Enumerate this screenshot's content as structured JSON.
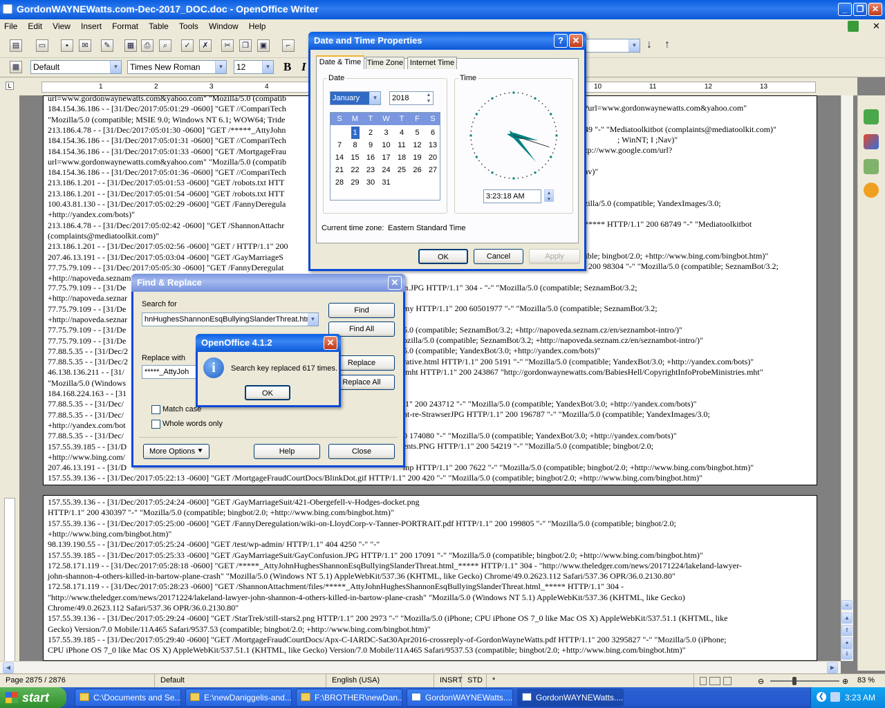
{
  "window": {
    "title": "GordonWAYNEWatts.com-Dec-2017_DOC.doc - OpenOffice Writer"
  },
  "menu": [
    "File",
    "Edit",
    "View",
    "Insert",
    "Format",
    "Table",
    "Tools",
    "Window",
    "Help"
  ],
  "format_toolbar": {
    "style": "Default",
    "font": "Times New Roman",
    "size": "12",
    "bold": "B",
    "italic": "I"
  },
  "ruler": {
    "ticks": [
      "1",
      "2",
      "3",
      "4",
      "5",
      "6",
      "7",
      "8",
      "9",
      "10",
      "11",
      "12",
      "13"
    ]
  },
  "page1_lines": [
    "url=www.gordonwaynewatts.com&yahoo.com\" \"Mozilla/5.0 (compatib",
    "184.154.36.186 - - [31/Dec/2017:05:01:29 -0600] \"GET //CompariTech",
    "\"Mozilla/5.0 (compatible; MSIE 9.0; Windows NT 6.1; WOW64; Tride",
    "213.186.4.78 - - [31/Dec/2017:05:01:30 -0600] \"GET /*****_AttyJohn",
    "184.154.36.186 - - [31/Dec/2017:05:01:31 -0600] \"GET //CompariTech",
    "184.154.36.186 - - [31/Dec/2017:05:01:33 -0600] \"GET /MortgageFrau",
    "url=www.gordonwaynewatts.com&yahoo.com\" \"Mozilla/5.0 (compatib",
    "184.154.36.186 - - [31/Dec/2017:05:01:36 -0600] \"GET //CompariTech",
    "213.186.1.201 - - [31/Dec/2017:05:01:53 -0600] \"GET /robots.txt HTT",
    "213.186.1.201 - - [31/Dec/2017:05:01:54 -0600] \"GET /robots.txt HTT",
    "100.43.81.130 - - [31/Dec/2017:05:02:29 -0600] \"GET /FannyDeregula",
    "+http://yandex.com/bots)\"",
    "213.186.4.78 - - [31/Dec/2017:05:02:42 -0600] \"GET /ShannonAttachr",
    "(complaints@mediatoolkit.com)\"",
    "213.186.1.201 - - [31/Dec/2017:05:02:56 -0600] \"GET / HTTP/1.1\" 200",
    "207.46.13.191 - - [31/Dec/2017:05:03:04 -0600] \"GET /GayMarriageS",
    "77.75.79.109 - - [31/Dec/2017:05:05:30 -0600] \"GET /FannyDeregulat",
    "+http://napoveda.seznam"
  ],
  "page1_right": [
    "?url=www.gordonwaynewatts.com&yahoo.com\"",
    "49 \"-\" \"Mediatoolkitbot (complaints@mediatoolkit.com)\"",
    "; WinNT; I ;Nav)\"",
    "ttp://www.google.com/url?",
    "av)\"",
    "zilla/5.0 (compatible; YandexImages/3.0;",
    "***** HTTP/1.1\" 200 68749 \"-\" \"Mediatoolkitbot",
    "tible; bingbot/2.0; +http://www.bing.com/bingbot.htm)\"",
    "\" 200 98304 \"-\" \"Mozilla/5.0 (compatible; SeznamBot/3.2;",
    "nan.JPG HTTP/1.1\" 304 - \"-\" \"Mozilla/5.0 (compatible; SeznamBot/3.2;",
    "my HTTP/1.1\" 200 60501977 \"-\" \"Mozilla/5.0 (compatible; SeznamBot/3.2;",
    "5.0 (compatible; SeznamBot/3.2; +http://napoveda.seznam.cz/en/seznambot-intro/)\"",
    "ozilla/5.0 (compatible; SeznamBot/3.2; +http://napoveda.seznam.cz/en/seznambot-intro/)\"",
    "5.0 (compatible; YandexBot/3.0; +http://yandex.com/bots)\"",
    "rative.html HTTP/1.1\" 200 5191 \"-\" \"Mozilla/5.0 (compatible; YandexBot/3.0; +http://yandex.com/bots)\"",
    ".mht HTTP/1.1\" 200 243867 \"http://gordonwaynewatts.com/BabiesHell/CopyrightInfoProbeMinistries.mht\"",
    ".1\" 200 243712 \"-\" \"Mozilla/5.0 (compatible; YandexBot/3.0; +http://yandex.com/bots)\"",
    "nt-re-StrawserJPG HTTP/1.1\" 200 196787 \"-\" \"Mozilla/5.0 (compatible; YandexImages/3.0;",
    "0 174080 \"-\" \"Mozilla/5.0 (compatible; YandexBot/3.0; +http://yandex.com/bots)\"",
    "ents.PNG HTTP/1.1\" 200 54219 \"-\" \"Mozilla/5.0 (compatible; bingbot/2.0;",
    "mp HTTP/1.1\" 200 7622 \"-\" \"Mozilla/5.0 (compatible; bingbot/2.0; +http://www.bing.com/bingbot.htm)\""
  ],
  "page1_left": [
    "77.75.79.109 - - [31/De",
    "+http://napoveda.seznar",
    "77.75.79.109 - - [31/De",
    "+http://napoveda.seznar",
    "77.75.79.109 - - [31/De",
    "77.75.79.109 - - [31/De",
    "77.88.5.35 - - [31/Dec/2",
    "77.88.5.35 - - [31/Dec/2",
    "46.138.136.211 - - [31/",
    "\"Mozilla/5.0 (Windows",
    "184.168.224.163 - - [31",
    "77.88.5.35 - - [31/Dec/",
    "77.88.5.35 - - [31/Dec/",
    "+http://yandex.com/bot",
    "77.88.5.35 - - [31/Dec/",
    "157.55.39.185 - - [31/D",
    "+http://www.bing.com/",
    "207.46.13.191 - - [31/D",
    "157.55.39.136 - - [31/Dec/2017:05:22:13 -0600] \"GET /MortgageFraudCourtDocs/BlinkDot.gif HTTP/1.1\" 200 420 \"-\" \"Mozilla/5.0 (compatible; bingbot/2.0; +http://www.bing.com/bingbot.htm)\""
  ],
  "page2_lines": [
    "157.55.39.136 - - [31/Dec/2017:05:24:24 -0600] \"GET /GayMarriageSuit/421-Obergefell-v-Hodges-docket.png",
    " HTTP/1.1\" 200 430397 \"-\" \"Mozilla/5.0 (compatible; bingbot/2.0; +http://www.bing.com/bingbot.htm)\"",
    "157.55.39.136 - - [31/Dec/2017:05:25:00 -0600] \"GET /FannyDeregulation/wiki-on-LloydCorp-v-Tanner-PORTRAIT.pdf HTTP/1.1\" 200 199805 \"-\" \"Mozilla/5.0 (compatible; bingbot/2.0;",
    "+http://www.bing.com/bingbot.htm)\"",
    "98.139.190.55 - - [31/Dec/2017:05:25:24 -0600] \"GET /test/wp-admin/ HTTP/1.1\" 404 4250 \"-\" \"-\"",
    "157.55.39.185 - - [31/Dec/2017:05:25:33 -0600] \"GET /GayMarriageSuit/GayConfusion.JPG HTTP/1.1\" 200 17091 \"-\" \"Mozilla/5.0 (compatible; bingbot/2.0; +http://www.bing.com/bingbot.htm)\"",
    "172.58.171.119 - - [31/Dec/2017:05:28:18 -0600] \"GET /*****_AttyJohnHughesShannonEsqBullyingSlanderThreat.html_***** HTTP/1.1\" 304 - \"http://www.theledger.com/news/20171224/lakeland-lawyer-",
    "john-shannon-4-others-killed-in-bartow-plane-crash\" \"Mozilla/5.0 (Windows NT 5.1) AppleWebKit/537.36 (KHTML, like Gecko) Chrome/49.0.2623.112 Safari/537.36 OPR/36.0.2130.80\"",
    "172.58.171.119 - - [31/Dec/2017:05:28:23 -0600] \"GET /ShannonAttachment/files/*****_AttyJohnHughesShannonEsqBullyingSlanderThreat.html_***** HTTP/1.1\" 304 -",
    "\"http://www.theledger.com/news/20171224/lakeland-lawyer-john-shannon-4-others-killed-in-bartow-plane-crash\" \"Mozilla/5.0 (Windows NT 5.1) AppleWebKit/537.36 (KHTML, like Gecko)",
    "Chrome/49.0.2623.112 Safari/537.36 OPR/36.0.2130.80\"",
    "157.55.39.136 - - [31/Dec/2017:05:29:24 -0600] \"GET /StarTrek/still-stars2.png HTTP/1.1\" 200 2973 \"-\" \"Mozilla/5.0 (iPhone; CPU iPhone OS 7_0 like Mac OS X) AppleWebKit/537.51.1 (KHTML, like",
    "Gecko) Version/7.0 Mobile/11A465 Safari/9537.53 (compatible; bingbot/2.0; +http://www.bing.com/bingbot.htm)\"",
    "157.55.39.185 - - [31/Dec/2017:05:29:40 -0600] \"GET /MortgageFraudCourtDocs/Apx-C-IARDC-Sat30Apr2016-crossreply-of-GordonWayneWatts.pdf HTTP/1.1\" 200 3295827 \"-\" \"Mozilla/5.0 (iPhone;",
    "CPU iPhone OS 7_0 like Mac OS X) AppleWebKit/537.51.1 (KHTML, like Gecko) Version/7.0 Mobile/11A465 Safari/9537.53 (compatible; bingbot/2.0; +http://www.bing.com/bingbot.htm)\""
  ],
  "datetime_dialog": {
    "title": "Date and Time Properties",
    "help": "?",
    "tabs": [
      "Date & Time",
      "Time Zone",
      "Internet Time"
    ],
    "date_label": "Date",
    "time_label": "Time",
    "month": "January",
    "year": "2018",
    "weekdays": [
      "S",
      "M",
      "T",
      "W",
      "T",
      "F",
      "S"
    ],
    "days": [
      [
        "",
        "1",
        "2",
        "3",
        "4",
        "5",
        "6"
      ],
      [
        "7",
        "8",
        "9",
        "10",
        "11",
        "12",
        "13"
      ],
      [
        "14",
        "15",
        "16",
        "17",
        "18",
        "19",
        "20"
      ],
      [
        "21",
        "22",
        "23",
        "24",
        "25",
        "26",
        "27"
      ],
      [
        "28",
        "29",
        "30",
        "31",
        "",
        "",
        ""
      ]
    ],
    "selected_day": "1",
    "time": "3:23:18 AM",
    "clock": {
      "hour": 3,
      "minute": 23,
      "second": 18
    },
    "timezone_label": "Current time zone:",
    "timezone": "Eastern Standard Time",
    "ok": "OK",
    "cancel": "Cancel",
    "apply": "Apply"
  },
  "find_replace": {
    "title": "Find & Replace",
    "search_label": "Search for",
    "search_value": "hnHughesShannonEsqBullyingSlanderThreat.html",
    "replace_label": "Replace with",
    "replace_value": "*****_AttyJoh",
    "find": "Find",
    "find_all": "Find All",
    "replace": "Replace",
    "replace_all": "Replace All",
    "match_case": "Match case",
    "whole_words": "Whole words only",
    "more_options": "More Options",
    "help": "Help",
    "close": "Close"
  },
  "alert": {
    "title": "OpenOffice 4.1.2",
    "message": "Search key replaced 617 times.",
    "ok": "OK"
  },
  "status": {
    "page": "Page 2875 / 2876",
    "style": "Default",
    "language": "English (USA)",
    "insert": "INSRT",
    "selection": "STD",
    "modified": "*",
    "zoom": "83 %"
  },
  "taskbar": {
    "start": "start",
    "items": [
      "C:\\Documents and Se...",
      "E:\\newDaniggelis-and...",
      "F:\\BROTHER\\newDan...",
      "GordonWAYNEWatts....",
      "GordonWAYNEWatts...."
    ],
    "clock": "3:23 AM"
  }
}
